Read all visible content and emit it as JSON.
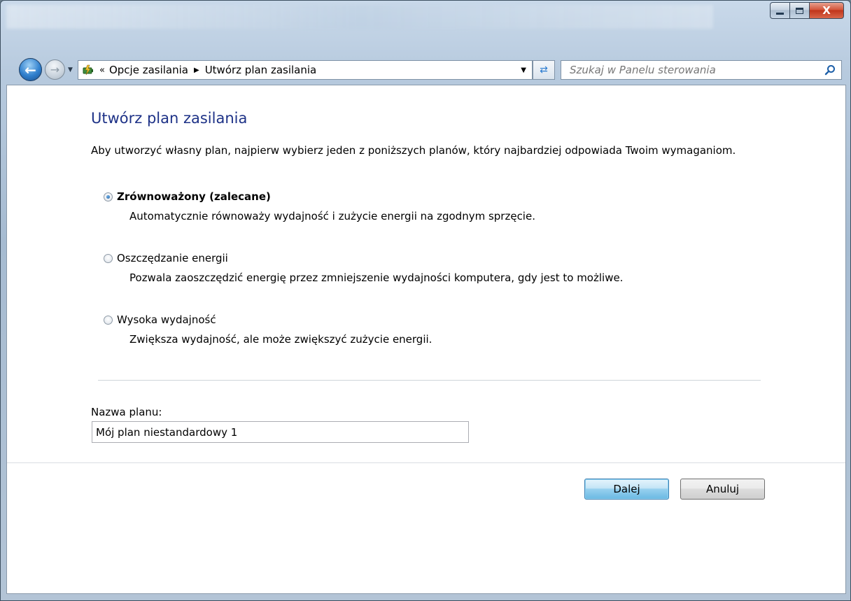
{
  "window": {
    "caption_close_label": "X"
  },
  "nav": {
    "address": {
      "overflow_marker": "«",
      "breadcrumbs": [
        "Opcje zasilania",
        "Utwórz plan zasilania"
      ]
    },
    "search": {
      "placeholder": "Szukaj w Panelu sterowania"
    }
  },
  "page": {
    "title": "Utwórz plan zasilania",
    "intro": "Aby utworzyć własny plan, najpierw wybierz jeden z poniższych planów, który najbardziej odpowiada Twoim wymaganiom.",
    "options": [
      {
        "label": "Zrównoważony (zalecane)",
        "description": "Automatycznie równoważy wydajność i zużycie energii na zgodnym sprzęcie.",
        "selected": true
      },
      {
        "label": "Oszczędzanie energii",
        "description": "Pozwala zaoszczędzić energię przez zmniejszenie wydajności komputera, gdy jest to możliwe.",
        "selected": false
      },
      {
        "label": "Wysoka wydajność",
        "description": "Zwiększa wydajność, ale może zwiększyć zużycie energii.",
        "selected": false
      }
    ],
    "plan_name": {
      "label": "Nazwa planu:",
      "value": "Mój plan niestandardowy 1"
    },
    "buttons": {
      "next": "Dalej",
      "cancel": "Anuluj"
    }
  },
  "colors": {
    "title": "#1e3287",
    "accent": "#2f7fcd"
  }
}
